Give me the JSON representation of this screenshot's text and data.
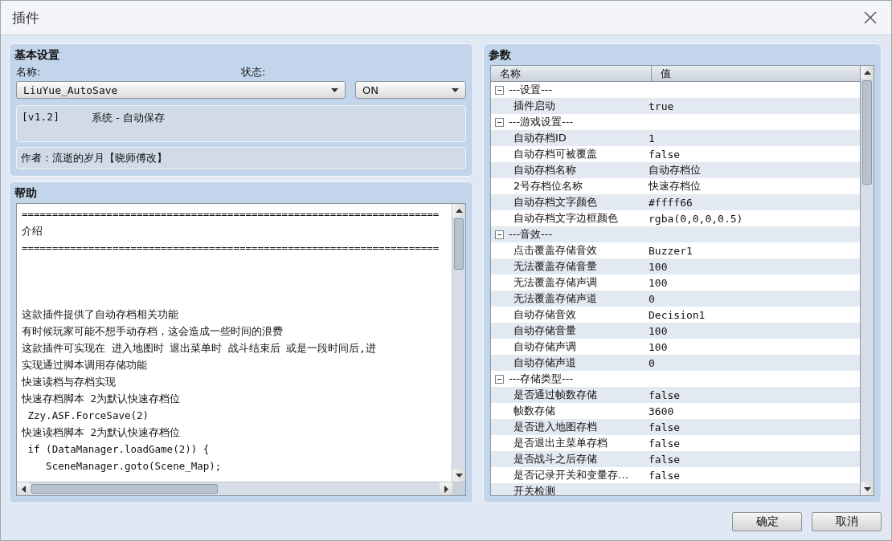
{
  "window": {
    "title": "插件"
  },
  "basic": {
    "title": "基本设置",
    "name_label": "名称:",
    "name_value": "LiuYue_AutoSave",
    "status_label": "状态:",
    "status_value": "ON",
    "version": "[v1.2]",
    "description": "系统 - 自动保存",
    "author": "作者：流逝的岁月【晓师傅改】"
  },
  "help": {
    "title": "帮助",
    "blocks": [
      [
        "=====================================================================",
        "介绍",
        "====================================================================="
      ],
      [
        "这款插件提供了自动存档相关功能",
        "有时候玩家可能不想手动存档，这会造成一些时间的浪费",
        "这款插件可实现在 进入地图时 退出菜单时 战斗结束后 或是一段时间后,进",
        "实现通过脚本调用存储功能",
        "快速读档与存档实现",
        "快速存档脚本 2为默认快速存档位",
        " Zzy.ASF.ForceSave(2)",
        "快速读档脚本 2为默认快速存档位",
        " if (DataManager.loadGame(2)) {",
        "    SceneManager.goto(Scene_Map);"
      ]
    ]
  },
  "params": {
    "title": "参数",
    "columns": [
      "名称",
      "值"
    ],
    "groups": [
      {
        "name": "---设置---",
        "expanded": true,
        "children": [
          {
            "name": "插件启动",
            "value": "true"
          }
        ]
      },
      {
        "name": "---游戏设置---",
        "expanded": true,
        "children": [
          {
            "name": "自动存档ID",
            "value": "1"
          },
          {
            "name": "自动存档可被覆盖",
            "value": "false"
          },
          {
            "name": "自动存档名称",
            "value": "自动存档位"
          },
          {
            "name": "2号存档位名称",
            "value": "快速存档位"
          },
          {
            "name": "自动存档文字颜色",
            "value": "#ffff66"
          },
          {
            "name": "自动存档文字边框颜色",
            "value": "rgba(0,0,0,0.5)"
          }
        ]
      },
      {
        "name": "---音效---",
        "expanded": true,
        "children": [
          {
            "name": "点击覆盖存储音效",
            "value": "Buzzer1"
          },
          {
            "name": "无法覆盖存储音量",
            "value": "100"
          },
          {
            "name": "无法覆盖存储声调",
            "value": "100"
          },
          {
            "name": "无法覆盖存储声道",
            "value": "0"
          },
          {
            "name": "自动存储音效",
            "value": "Decision1"
          },
          {
            "name": "自动存储音量",
            "value": "100"
          },
          {
            "name": "自动存储声调",
            "value": "100"
          },
          {
            "name": "自动存储声道",
            "value": "0"
          }
        ]
      },
      {
        "name": "---存储类型---",
        "expanded": true,
        "children": [
          {
            "name": "是否通过帧数存储",
            "value": "false"
          },
          {
            "name": "帧数存储",
            "value": "3600"
          },
          {
            "name": "是否进入地图存档",
            "value": "false"
          },
          {
            "name": "是否退出主菜单存档",
            "value": "false"
          },
          {
            "name": "是否战斗之后存储",
            "value": "false"
          },
          {
            "name": "是否记录开关和变量存…",
            "value": "false"
          },
          {
            "name": "开关检测"
          }
        ]
      }
    ]
  },
  "buttons": [
    "确定",
    "取消"
  ]
}
